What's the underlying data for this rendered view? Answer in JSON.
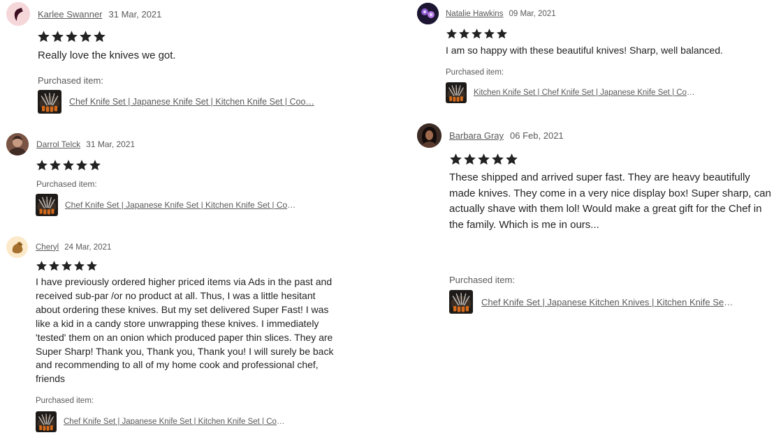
{
  "colors": {
    "text": "#222222",
    "muted": "#595959",
    "star": "#222222"
  },
  "reviews": [
    {
      "reviewer": "Karlee Swanner",
      "date": "31 Mar, 2021",
      "rating": 5,
      "text": "Really love the knives we got.",
      "purchased_label": "Purchased item:",
      "item_title": "Chef Knife Set | Japanese Knife Set | Kitchen Knife Set | Coo…",
      "avatar_icon": "bird-icon"
    },
    {
      "reviewer": "Darrol Telck",
      "date": "31 Mar, 2021",
      "rating": 5,
      "text": "",
      "purchased_label": "Purchased item:",
      "item_title": "Chef Knife Set | Japanese Knife Set | Kitchen Knife Set | Coo…",
      "avatar_icon": "person-photo-icon"
    },
    {
      "reviewer": "Cheryl",
      "date": "24 Mar, 2021",
      "rating": 5,
      "text": "I have previously ordered higher priced items via Ads in the past and received sub-par /or no product at all. Thus, I was a little hesitant about ordering these knives. But my set delivered Super Fast! I was like a kid in a candy store unwrapping these knives. I immediately 'tested' them on an onion which produced paper thin slices. They are Super Sharp! Thank you, Thank you, Thank you! I will surely be back and recommending to all of my home cook and professional chef, friends",
      "purchased_label": "Purchased item:",
      "item_title": "Chef Knife Set | Japanese Knife Set | Kitchen Knife Set | Coo…",
      "avatar_icon": "bird-icon"
    },
    {
      "reviewer": "Natalie Hawkins",
      "date": "09 Mar, 2021",
      "rating": 5,
      "text": "I am so happy with these beautiful knives! Sharp, well balanced.",
      "purchased_label": "Purchased item:",
      "item_title": "Kitchen Knife Set | Chef Knife Set | Japanese Knife Set | Coo…",
      "avatar_icon": "paw-icon"
    },
    {
      "reviewer": "Barbara Gray",
      "date": "06 Feb, 2021",
      "rating": 5,
      "text": "These shipped and arrived super fast. They are heavy beautifully made knives. They come in a very nice display box! Super sharp, can actually shave with them lol! Would make a great gift for the Chef in the family. Which is me in ours...",
      "purchased_label": "Purchased item:",
      "item_title": "Chef Knife Set | Japanese Kitchen Knives | Kitchen Knife Set…",
      "avatar_icon": "person-photo-icon"
    }
  ]
}
